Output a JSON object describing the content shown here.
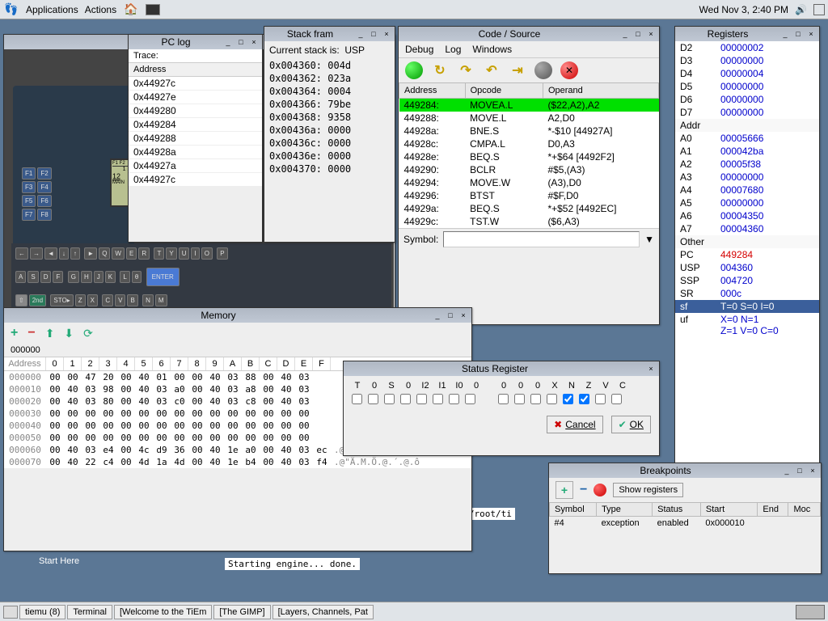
{
  "top_panel": {
    "applications": "Applications",
    "actions": "Actions",
    "datetime": "Wed Nov  3,  2:40 PM"
  },
  "desktop": {
    "start_here": "Start Here"
  },
  "pclog": {
    "title": "PC log",
    "trace": "Trace:",
    "col_address": "Address",
    "rows": [
      "0x44927c",
      "0x44927e",
      "0x449280",
      "0x449284",
      "0x449288",
      "0x44928a",
      "0x44927a",
      "0x44927c"
    ]
  },
  "stack": {
    "title": "Stack fram",
    "current": "Current stack is:",
    "which": "USP",
    "rows": [
      [
        "0x004360:",
        "004d"
      ],
      [
        "0x004362:",
        "023a"
      ],
      [
        "0x004364:",
        "0004"
      ],
      [
        "0x004366:",
        "79be"
      ],
      [
        "0x004368:",
        "9358"
      ],
      [
        "0x00436a:",
        "0000"
      ],
      [
        "0x00436c:",
        "0000"
      ],
      [
        "0x00436e:",
        "0000"
      ],
      [
        "0x004370:",
        "0000"
      ]
    ]
  },
  "code": {
    "title": "Code / Source",
    "menu": [
      "Debug",
      "Log",
      "Windows"
    ],
    "cols": [
      "Address",
      "Opcode",
      "Operand"
    ],
    "rows": [
      [
        "449284:",
        "MOVEA.L",
        "($22,A2),A2",
        true
      ],
      [
        "449288:",
        "MOVE.L",
        "A2,D0",
        false
      ],
      [
        "44928a:",
        "BNE.S",
        "*-$10 [44927A]",
        false
      ],
      [
        "44928c:",
        "CMPA.L",
        "D0,A3",
        false
      ],
      [
        "44928e:",
        "BEQ.S",
        "*+$64 [4492F2]",
        false
      ],
      [
        "449290:",
        "BCLR",
        "#$5,(A3)",
        false
      ],
      [
        "449294:",
        "MOVE.W",
        "(A3),D0",
        false
      ],
      [
        "449296:",
        "BTST",
        "#$F,D0",
        false
      ],
      [
        "44929a:",
        "BEQ.S",
        "*+$52 [4492EC]",
        false
      ],
      [
        "44929c:",
        "TST.W",
        "($6,A3)",
        false
      ]
    ],
    "symbol_label": "Symbol:"
  },
  "registers": {
    "title": "Registers",
    "dregs": [
      [
        "D2",
        "00000002"
      ],
      [
        "D3",
        "00000000"
      ],
      [
        "D4",
        "00000004"
      ],
      [
        "D5",
        "00000000"
      ],
      [
        "D6",
        "00000000"
      ],
      [
        "D7",
        "00000000"
      ]
    ],
    "addr_label": "Addr",
    "aregs": [
      [
        "A0",
        "00005666"
      ],
      [
        "A1",
        "000042ba"
      ],
      [
        "A2",
        "00005f38"
      ],
      [
        "A3",
        "00000000"
      ],
      [
        "A4",
        "00007680"
      ],
      [
        "A5",
        "00000000"
      ],
      [
        "A6",
        "00004350"
      ],
      [
        "A7",
        "00004360"
      ]
    ],
    "other_label": "Other",
    "pc": [
      "PC",
      "449284"
    ],
    "usp": [
      "USP",
      "004360"
    ],
    "ssp": [
      "SSP",
      "004720"
    ],
    "sr": [
      "SR",
      "000c"
    ],
    "sf": [
      "sf",
      "T=0  S=0  I=0"
    ],
    "uf": [
      "uf",
      "X=0  N=1",
      "Z=1  V=0  C=0"
    ]
  },
  "memory": {
    "title": "Memory",
    "addr_input": "000000",
    "col_address": "Address",
    "cols": [
      "0",
      "1",
      "2",
      "3",
      "4",
      "5",
      "6",
      "7",
      "8",
      "9",
      "A",
      "B",
      "C",
      "D",
      "E",
      "F"
    ],
    "rows": [
      {
        "a": "000000",
        "b": [
          "00",
          "00",
          "47",
          "20",
          "00",
          "40",
          "01",
          "00",
          "00",
          "40",
          "03",
          "88",
          "00",
          "40",
          "03"
        ],
        "s": ""
      },
      {
        "a": "000010",
        "b": [
          "00",
          "40",
          "03",
          "98",
          "00",
          "40",
          "03",
          "a0",
          "00",
          "40",
          "03",
          "a8",
          "00",
          "40",
          "03"
        ],
        "s": ""
      },
      {
        "a": "000020",
        "b": [
          "00",
          "40",
          "03",
          "80",
          "00",
          "40",
          "03",
          "c0",
          "00",
          "40",
          "03",
          "c8",
          "00",
          "40",
          "03"
        ],
        "s": ""
      },
      {
        "a": "000030",
        "b": [
          "00",
          "00",
          "00",
          "00",
          "00",
          "00",
          "00",
          "00",
          "00",
          "00",
          "00",
          "00",
          "00",
          "00",
          "00"
        ],
        "s": ""
      },
      {
        "a": "000040",
        "b": [
          "00",
          "00",
          "00",
          "00",
          "00",
          "00",
          "00",
          "00",
          "00",
          "00",
          "00",
          "00",
          "00",
          "00",
          "00"
        ],
        "s": ""
      },
      {
        "a": "000050",
        "b": [
          "00",
          "00",
          "00",
          "00",
          "00",
          "00",
          "00",
          "00",
          "00",
          "00",
          "00",
          "00",
          "00",
          "00",
          "00"
        ],
        "s": ""
      },
      {
        "a": "000060",
        "b": [
          "00",
          "40",
          "03",
          "e4",
          "00",
          "4c",
          "d9",
          "36",
          "00",
          "40",
          "1e",
          "a0",
          "00",
          "40",
          "03",
          "ec"
        ],
        "s": ".@.ä.LÙ6.@. .@.ì"
      },
      {
        "a": "000070",
        "b": [
          "00",
          "40",
          "22",
          "c4",
          "00",
          "4d",
          "1a",
          "4d",
          "00",
          "40",
          "1e",
          "b4",
          "00",
          "40",
          "03",
          "f4"
        ],
        "s": ".@\"Ä.M.Ö.@.´.@.ô"
      }
    ]
  },
  "status_reg": {
    "title": "Status Register",
    "labels1": [
      "T",
      "0",
      "S",
      "0",
      "I2",
      "I1",
      "I0",
      "0"
    ],
    "labels2": [
      "0",
      "0",
      "0",
      "X",
      "N",
      "Z",
      "V",
      "C"
    ],
    "checks2": [
      false,
      false,
      false,
      false,
      true,
      true,
      false,
      false
    ],
    "cancel": "Cancel",
    "ok": "OK"
  },
  "breakpoints": {
    "title": "Breakpoints",
    "show_registers": "Show registers",
    "cols": [
      "Symbol",
      "Type",
      "Status",
      "Start",
      "End",
      "Moc"
    ],
    "row": [
      "#4",
      "exception",
      "enabled",
      "0x000010",
      "",
      ""
    ]
  },
  "taskbar": {
    "items": [
      "tiemu (8)",
      "Terminal",
      "[Welcome to the TiEm",
      "[The GIMP]",
      "[Layers, Channels, Pat"
    ]
  },
  "terminal_snippet": {
    "line1": "): /root/ti",
    "line2": "Starting engine... done."
  },
  "calc": {
    "time": "12"
  }
}
